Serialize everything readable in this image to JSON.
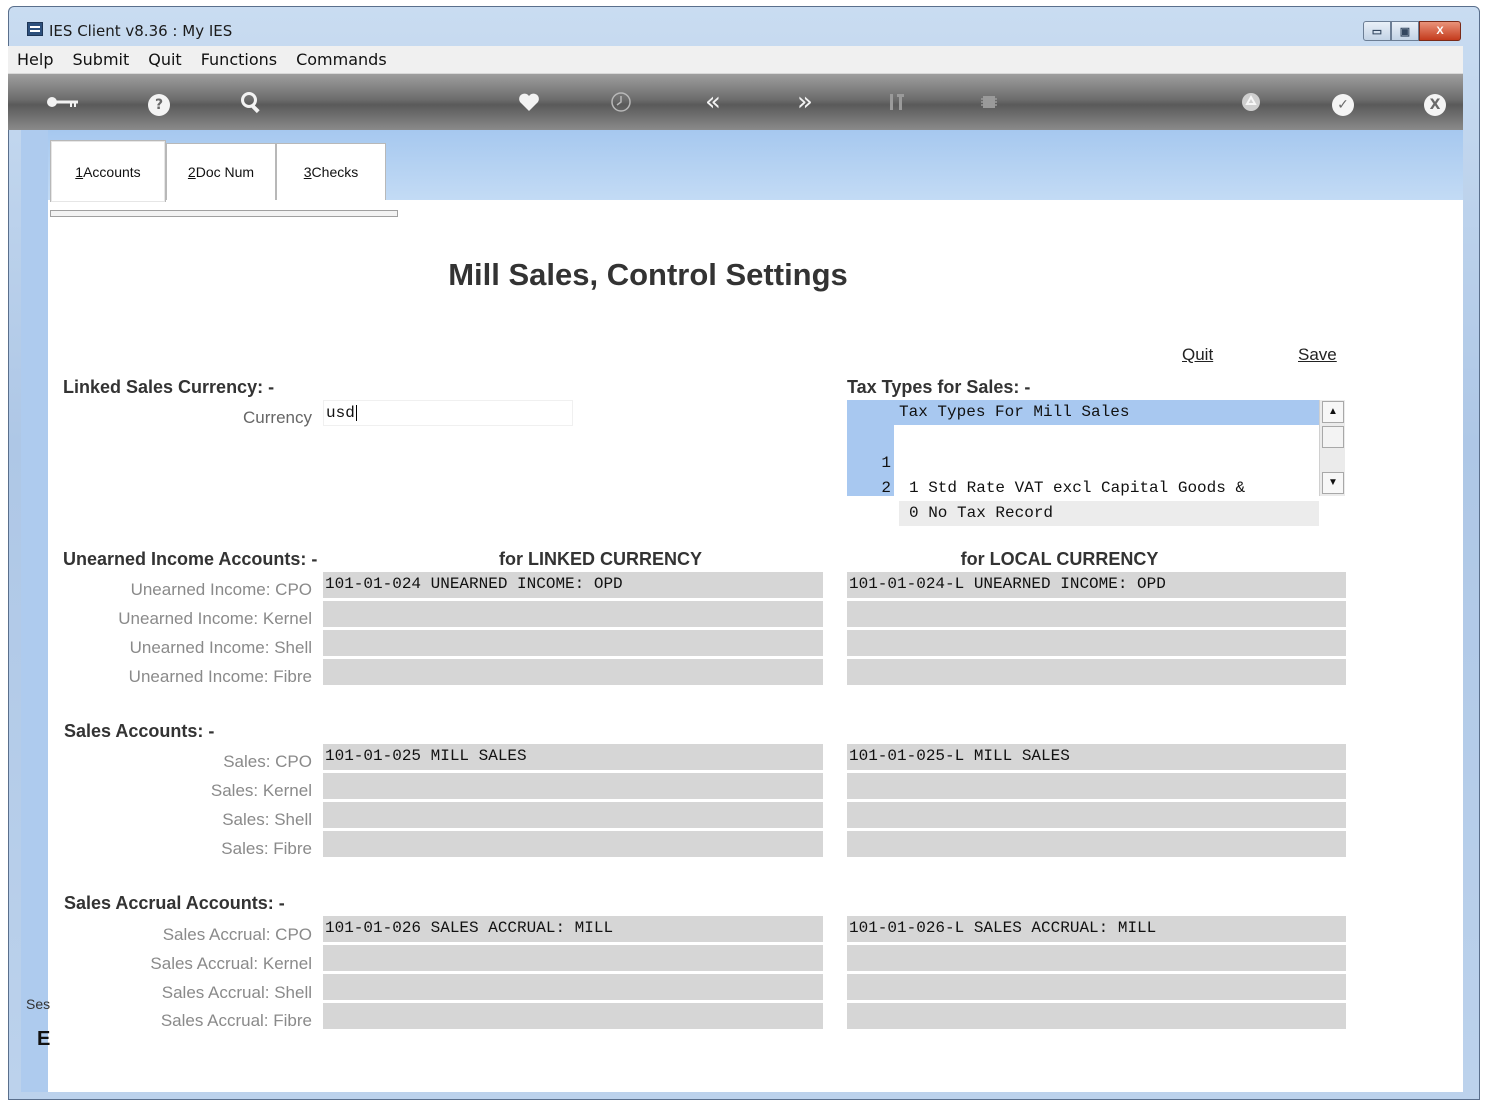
{
  "window": {
    "title": "IES Client v8.36 : My IES",
    "controls": {
      "minimize": "▭",
      "maximize": "▣",
      "close": "X"
    }
  },
  "menu": [
    "Help",
    "Submit",
    "Quit",
    "Functions",
    "Commands"
  ],
  "toolbar": {
    "icons": [
      "key-icon",
      "help-icon",
      "search-icon",
      "heart-icon",
      "clock-icon",
      "back-icon",
      "forward-icon",
      "tools-icon",
      "chip-icon",
      "recycle-icon",
      "check-icon",
      "close-icon"
    ],
    "help_glyph": "?",
    "check_glyph": "✓",
    "close_glyph": "X",
    "back_glyph": "«",
    "forward_glyph": "»"
  },
  "tabs": [
    {
      "key": "1",
      "label": " Accounts"
    },
    {
      "key": "2",
      "label": " Doc Num"
    },
    {
      "key": "3",
      "label": " Checks"
    }
  ],
  "page_title": "Mill Sales, Control Settings",
  "actions": {
    "quit": "Quit",
    "save": "Save"
  },
  "linked_currency": {
    "heading": "Linked Sales Currency: -",
    "currency_label": "Currency",
    "currency_value": "usd"
  },
  "tax_types": {
    "heading": "Tax Types for Sales: -",
    "grid_header": "Tax Types For Mill Sales",
    "rows": [
      {
        "num": "1",
        "text": "1 Std Rate VAT excl Capital Goods &"
      },
      {
        "num": "2",
        "text": "0 No Tax Record"
      }
    ]
  },
  "columns": {
    "linked": "for LINKED CURRENCY",
    "local": "for LOCAL CURRENCY"
  },
  "unearned": {
    "heading": "Unearned Income Accounts: -",
    "rows": [
      {
        "label": "Unearned Income: CPO",
        "linked": "101-01-024 UNEARNED INCOME: OPD",
        "local": "101-01-024-L UNEARNED INCOME: OPD"
      },
      {
        "label": "Unearned Income: Kernel",
        "linked": "",
        "local": ""
      },
      {
        "label": "Unearned Income: Shell",
        "linked": "",
        "local": ""
      },
      {
        "label": "Unearned Income: Fibre",
        "linked": "",
        "local": ""
      }
    ]
  },
  "sales": {
    "heading": "Sales Accounts: -",
    "rows": [
      {
        "label": "Sales: CPO",
        "linked": "101-01-025 MILL SALES",
        "local": "101-01-025-L MILL SALES"
      },
      {
        "label": "Sales: Kernel",
        "linked": "",
        "local": ""
      },
      {
        "label": "Sales: Shell",
        "linked": "",
        "local": ""
      },
      {
        "label": "Sales: Fibre",
        "linked": "",
        "local": ""
      }
    ]
  },
  "accrual": {
    "heading": "Sales Accrual Accounts: -",
    "rows": [
      {
        "label": "Sales Accrual: CPO",
        "linked": "101-01-026 SALES ACCRUAL: MILL",
        "local": "101-01-026-L SALES ACCRUAL: MILL"
      },
      {
        "label": "Sales Accrual: Kernel",
        "linked": "",
        "local": ""
      },
      {
        "label": "Sales Accrual: Shell",
        "linked": "",
        "local": ""
      },
      {
        "label": "Sales Accrual: Fibre",
        "linked": "",
        "local": ""
      }
    ]
  },
  "side": {
    "session_label": "Ses",
    "glyph": "E"
  },
  "colors": {
    "toolbar": "#6d6d6d",
    "grid_header": "#a8c8f0",
    "field_bg": "#d6d6d6"
  }
}
